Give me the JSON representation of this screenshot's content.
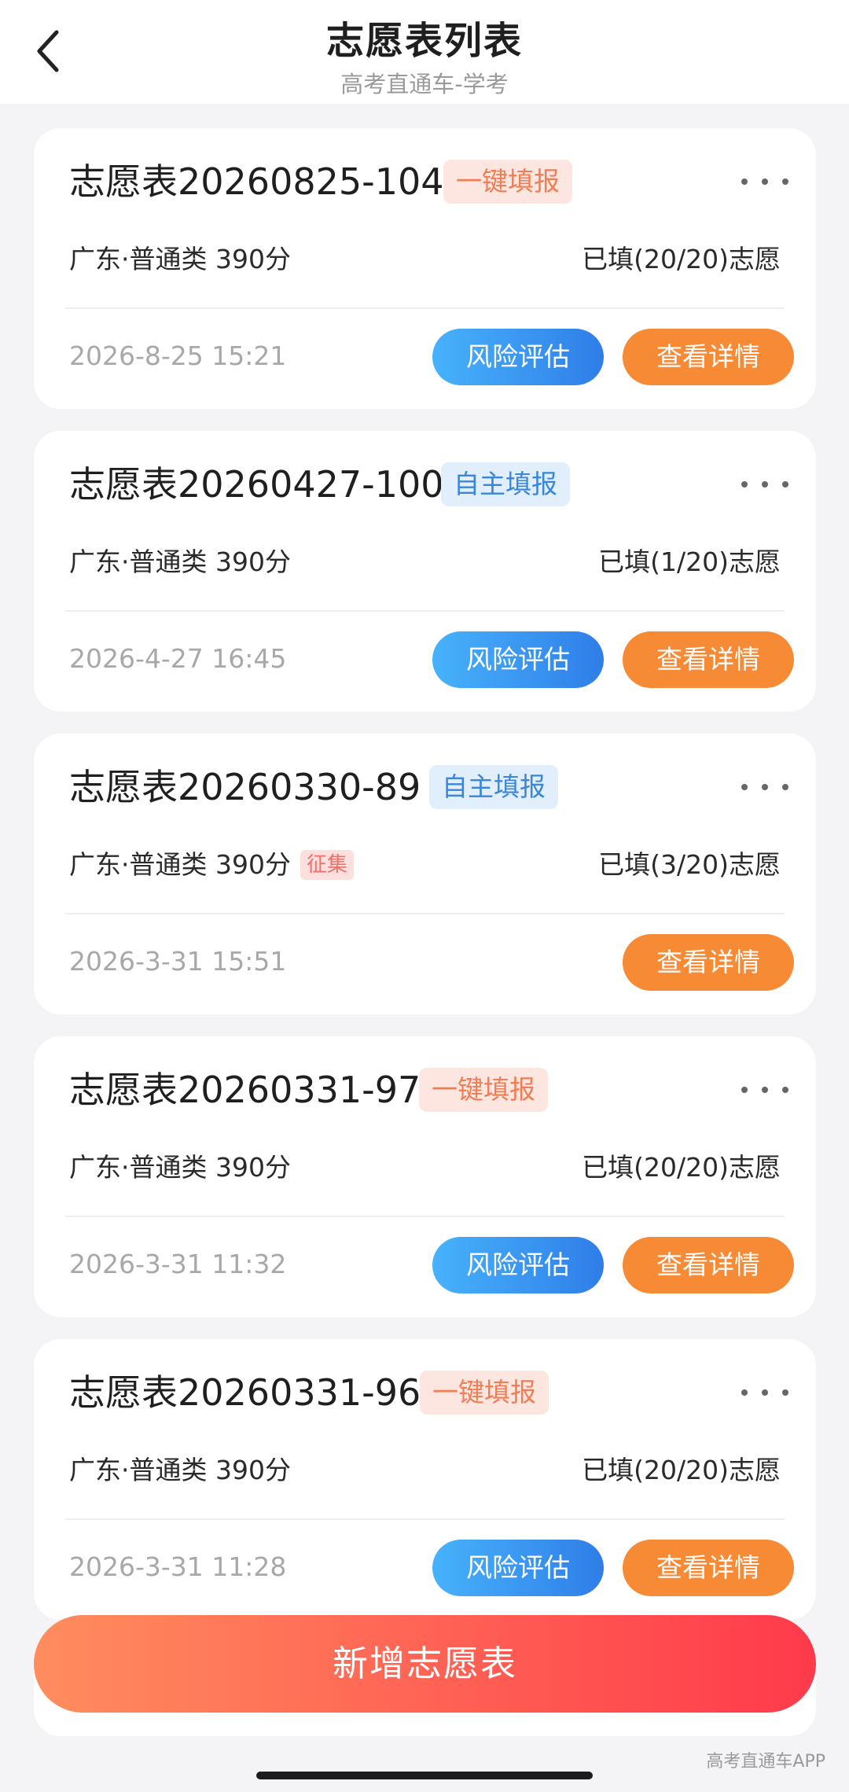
{
  "header": {
    "title": "志愿表列表",
    "subtitle": "高考直通车-学考",
    "back_icon": "chevron-left-icon"
  },
  "cards": [
    {
      "title": "志愿表20260825-104",
      "tag": "一键填报",
      "tag_color": "orange",
      "info": "广东·普通类 390分",
      "filled": "已填(20/20)志愿",
      "date": "2026-8-25 15:21",
      "risk_label": "风险评估",
      "detail_label": "查看详情"
    },
    {
      "title": "志愿表20260427-100",
      "tag": "自主填报",
      "tag_color": "blue",
      "info": "广东·普通类 390分",
      "filled": "已填(1/20)志愿",
      "date": "2026-4-27 16:45",
      "risk_label": "风险评估",
      "detail_label": "查看详情"
    },
    {
      "title": "志愿表20260330-89",
      "tag": "自主填报",
      "tag_color": "blue",
      "info": "广东·普通类 390分",
      "extra_tag": "征集",
      "filled": "已填(3/20)志愿",
      "date": "2026-3-31 15:51",
      "detail_label": "查看详情"
    },
    {
      "title": "志愿表20260331-97",
      "tag": "一键填报",
      "tag_color": "orange",
      "info": "广东·普通类 390分",
      "filled": "已填(20/20)志愿",
      "date": "2026-3-31 11:32",
      "risk_label": "风险评估",
      "detail_label": "查看详情"
    },
    {
      "title": "志愿表20260331-96",
      "tag": "一键填报",
      "tag_color": "orange",
      "info": "广东·普通类 390分",
      "filled": "已填(20/20)志愿",
      "date": "2026-3-31 11:28",
      "risk_label": "风险评估",
      "detail_label": "查看详情"
    }
  ],
  "footer": {
    "add_label": "新增志愿表",
    "watermark": "高考直通车APP"
  },
  "colors": {
    "orange_tag_bg": "#fde6df",
    "orange_tag_text": "#ef7d55",
    "blue_tag_bg": "#e1eefc",
    "blue_tag_text": "#3b86d8",
    "risk_button": "#2f7ee8",
    "detail_button": "#f78a35",
    "add_button_start": "#ff8d5e",
    "add_button_end": "#ff3a4b"
  }
}
